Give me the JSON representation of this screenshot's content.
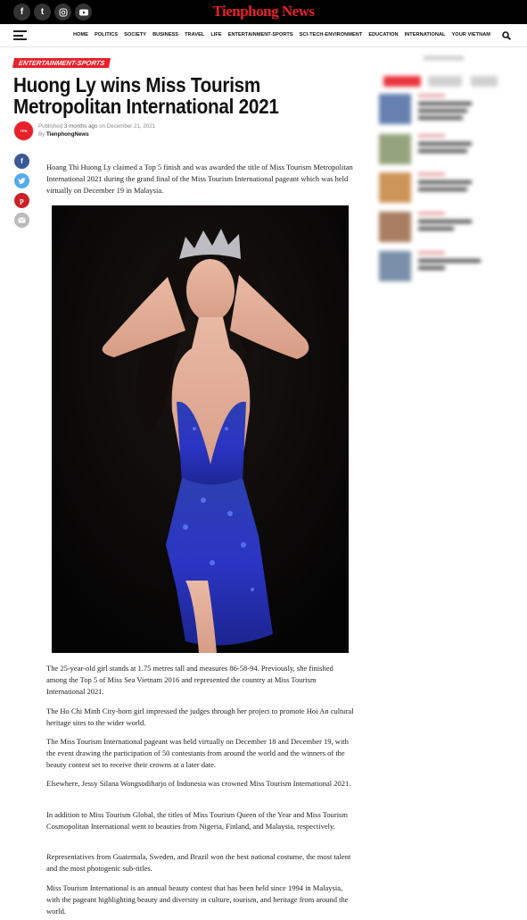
{
  "brand": {
    "name": "Tienphong News",
    "accent": "#e8202a"
  },
  "top_social": [
    "facebook-icon",
    "twitter-icon",
    "instagram-icon",
    "youtube-icon"
  ],
  "nav": {
    "items": [
      "HOME",
      "POLITICS",
      "SOCIETY",
      "BUSINESS",
      "TRAVEL",
      "LIFE",
      "ENTERTAINMENT-SPORTS",
      "SCI-TECH-ENVIRONMENT",
      "EDUCATION",
      "INTERNATIONAL",
      "YOUR VIETNAM"
    ]
  },
  "article": {
    "category": "ENTERTAINMENT-SPORTS",
    "title": "Huong Ly wins Miss Tourism Metropolitan International 2021",
    "published_prefix": "Published",
    "published_ago": "3 months ago",
    "published_on": "on",
    "published_date": "December 21, 2021",
    "by_prefix": "By",
    "author": "TienphongNews",
    "lead": "Hoang Thi Huong Ly claimed a Top 5 finish and was awarded the title of Miss Tourism Metropolitan International 2021 during the grand final of the Miss Tourism International pageant which was held virtually on December 19 in Malaysia.",
    "paragraphs": [
      "The 25-year-old girl stands at 1.75 metres tall and measures 86-58-94. Previously, she finished among the Top 5 of Miss Sea Vietnam 2016 and represented the country at Miss Tourism International 2021.",
      "The Ho Chi Minh City-born girl impressed the judges through her project to promote Hoi An cultural heritage sites to the wider world.",
      "The Miss Tourism International pageant was held virtually on December 18 and December 19, with the event drawing the participation of 50 contestants from around the world and the winners of the beauty contest set to receive their crowns at a later date.",
      "Elsewhere, Jessy Silana Wongsodiharjo of Indonesia was crowned Miss Tourism International 2021.",
      "In addition to Miss Tourism Global, the titles of Miss Tourism Queen of the Year and Miss Tourism Cosmopolitan International went to beauties from Nigeria, Finland, and Malaysia, respectively.",
      "Representatives from Guatemala, Sweden, and Brazil won the best national costume, the most talent and the most photogenic sub-titles.",
      "Miss Tourism International is an annual beauty contest that has been held since 1994 in Malaysia, with the pageant highlighting beauty and diversity in culture, tourism, and heritage from around the world."
    ]
  },
  "share": [
    {
      "icon": "facebook-icon",
      "color": "#3b5998",
      "glyph": "f"
    },
    {
      "icon": "twitter-icon",
      "color": "#55acee",
      "glyph": "t"
    },
    {
      "icon": "pinterest-icon",
      "color": "#cb2027",
      "glyph": "p"
    },
    {
      "icon": "email-icon",
      "color": "#bbbbbb",
      "glyph": "✉"
    }
  ]
}
